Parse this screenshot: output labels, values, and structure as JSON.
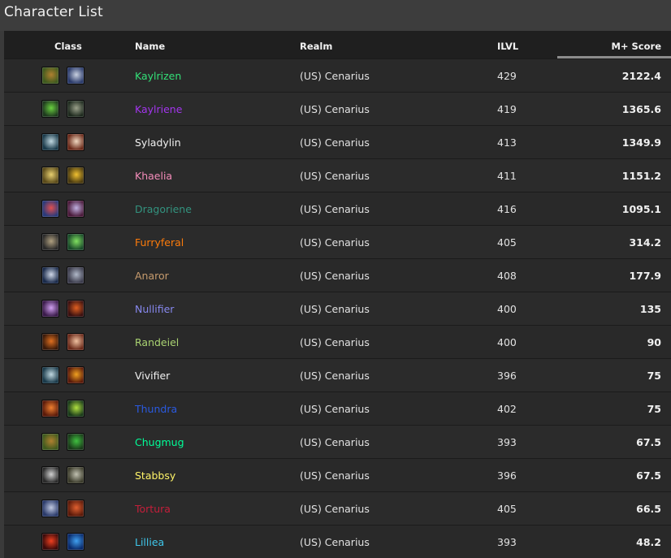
{
  "page": {
    "title": "Character List"
  },
  "columns": {
    "class": "Class",
    "name": "Name",
    "realm": "Realm",
    "ilvl": "ILVL",
    "score": "M+ Score"
  },
  "rows": [
    {
      "name": "Kaylrizen",
      "color": "#33e078",
      "realm": "(US) Cenarius",
      "ilvl": "429",
      "score": "2122.4",
      "icons": [
        [
          "spec-icon",
          "#3f5a1e",
          "#b08030"
        ],
        [
          "spec-icon",
          "#2a3a6a",
          "#c8d0e0"
        ]
      ]
    },
    {
      "name": "Kaylriene",
      "color": "#a335ee",
      "realm": "(US) Cenarius",
      "ilvl": "419",
      "score": "1365.6",
      "icons": [
        [
          "spec-icon",
          "#1e3a1e",
          "#6ad040"
        ],
        [
          "spec-icon",
          "#1e2a1e",
          "#9aa08a"
        ]
      ]
    },
    {
      "name": "Syladylin",
      "color": "#f0f0f0",
      "realm": "(US) Cenarius",
      "ilvl": "413",
      "score": "1349.9",
      "icons": [
        [
          "spec-icon",
          "#1a3a4a",
          "#c0d8e0"
        ],
        [
          "spec-icon",
          "#6a2a1a",
          "#f0d8c0"
        ]
      ]
    },
    {
      "name": "Khaelia",
      "color": "#f48cba",
      "realm": "(US) Cenarius",
      "ilvl": "411",
      "score": "1151.2",
      "icons": [
        [
          "spec-icon",
          "#5a4a1a",
          "#e8d070"
        ],
        [
          "spec-icon",
          "#4a3a10",
          "#f0c030"
        ]
      ]
    },
    {
      "name": "Dragoriene",
      "color": "#33937f",
      "realm": "(US) Cenarius",
      "ilvl": "416",
      "score": "1095.1",
      "icons": [
        [
          "spec-icon",
          "#2a3a7a",
          "#e05050"
        ],
        [
          "spec-icon",
          "#4a1a3a",
          "#c0b0e0"
        ]
      ]
    },
    {
      "name": "Furryferal",
      "color": "#ff7c0a",
      "realm": "(US) Cenarius",
      "ilvl": "405",
      "score": "314.2",
      "icons": [
        [
          "spec-icon",
          "#2a2a2a",
          "#b0a080"
        ],
        [
          "spec-icon",
          "#1a4a2a",
          "#80e060"
        ]
      ]
    },
    {
      "name": "Anaror",
      "color": "#c69b6d",
      "realm": "(US) Cenarius",
      "ilvl": "408",
      "score": "177.9",
      "icons": [
        [
          "spec-icon",
          "#1a2a4a",
          "#d0d8e8"
        ],
        [
          "spec-icon",
          "#3a3a4a",
          "#b0b8c8"
        ]
      ]
    },
    {
      "name": "Nullifier",
      "color": "#8788ee",
      "realm": "(US) Cenarius",
      "ilvl": "400",
      "score": "135",
      "icons": [
        [
          "spec-icon",
          "#3a1a4a",
          "#d0a0f0"
        ],
        [
          "spec-icon",
          "#3a1010",
          "#e06020"
        ]
      ]
    },
    {
      "name": "Randeiel",
      "color": "#aad372",
      "realm": "(US) Cenarius",
      "ilvl": "400",
      "score": "90",
      "icons": [
        [
          "spec-icon",
          "#3a1a0a",
          "#e07020"
        ],
        [
          "spec-icon",
          "#6a2a1a",
          "#f0c0a0"
        ]
      ]
    },
    {
      "name": "Vivifier",
      "color": "#f0f0f0",
      "realm": "(US) Cenarius",
      "ilvl": "396",
      "score": "75",
      "icons": [
        [
          "spec-icon",
          "#1a3a4a",
          "#c0d8e0"
        ],
        [
          "spec-icon",
          "#5a1a0a",
          "#f0a020"
        ]
      ]
    },
    {
      "name": "Thundra",
      "color": "#2a5ae0",
      "realm": "(US) Cenarius",
      "ilvl": "402",
      "score": "75",
      "icons": [
        [
          "spec-icon",
          "#5a1a0a",
          "#f08030"
        ],
        [
          "spec-icon",
          "#1a3a1a",
          "#b0e040"
        ]
      ]
    },
    {
      "name": "Chugmug",
      "color": "#00ff98",
      "realm": "(US) Cenarius",
      "ilvl": "393",
      "score": "67.5",
      "icons": [
        [
          "spec-icon",
          "#3f5a1e",
          "#b08030"
        ],
        [
          "spec-icon",
          "#1a3a1a",
          "#40c040"
        ]
      ]
    },
    {
      "name": "Stabbsy",
      "color": "#fff468",
      "realm": "(US) Cenarius",
      "ilvl": "396",
      "score": "67.5",
      "icons": [
        [
          "spec-icon",
          "#2a2a2a",
          "#d0d0d0"
        ],
        [
          "spec-icon",
          "#3a3a2a",
          "#c0c0b0"
        ]
      ]
    },
    {
      "name": "Tortura",
      "color": "#c41e3a",
      "realm": "(US) Cenarius",
      "ilvl": "405",
      "score": "66.5",
      "icons": [
        [
          "spec-icon",
          "#2a3a6a",
          "#c0c8e0"
        ],
        [
          "spec-icon",
          "#5a1a0a",
          "#e06030"
        ]
      ]
    },
    {
      "name": "Lilliea",
      "color": "#3fc7eb",
      "realm": "(US) Cenarius",
      "ilvl": "393",
      "score": "48.2",
      "icons": [
        [
          "spec-icon",
          "#3a0a0a",
          "#f04020"
        ],
        [
          "spec-icon",
          "#0a2a6a",
          "#40a0f0"
        ]
      ]
    }
  ]
}
